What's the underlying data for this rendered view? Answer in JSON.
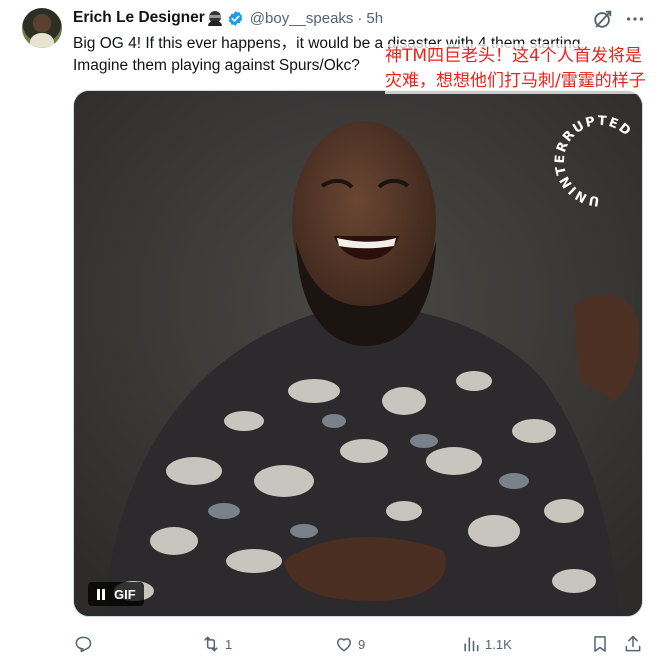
{
  "tweet": {
    "author": {
      "display_name": "Erich Le Designer",
      "name_emoji_icon": "ninja-icon",
      "verified_icon": "verified-badge-icon",
      "handle": "@boy__speaks",
      "separator": "·",
      "time": "5h"
    },
    "header_icons": [
      "grok-icon",
      "more-icon"
    ],
    "text_lines": [
      "Big OG 4! If this ever happens，it would be a disaster with 4 them starting.",
      "Imagine them playing against Spurs/Okc?"
    ],
    "annotation_lines": [
      "神TM四巨老头！这4个人首发将是",
      "灾难，想想他们打马刺/雷霆的样子"
    ],
    "media": {
      "badge_label": "GIF",
      "badge_icon": "pause-icon",
      "watermark": "UNINTERRUPTED"
    },
    "actions": {
      "reply": {
        "icon": "reply-icon",
        "count": ""
      },
      "repost": {
        "icon": "repost-icon",
        "count": "1"
      },
      "like": {
        "icon": "like-icon",
        "count": "9"
      },
      "views": {
        "icon": "views-icon",
        "count": "1.1K"
      },
      "bookmark": {
        "icon": "bookmark-icon"
      },
      "share": {
        "icon": "share-icon"
      }
    }
  },
  "colors": {
    "accent_verified": "#1d9bf0",
    "annotation_red": "#e8231b",
    "secondary_text": "#536471"
  }
}
